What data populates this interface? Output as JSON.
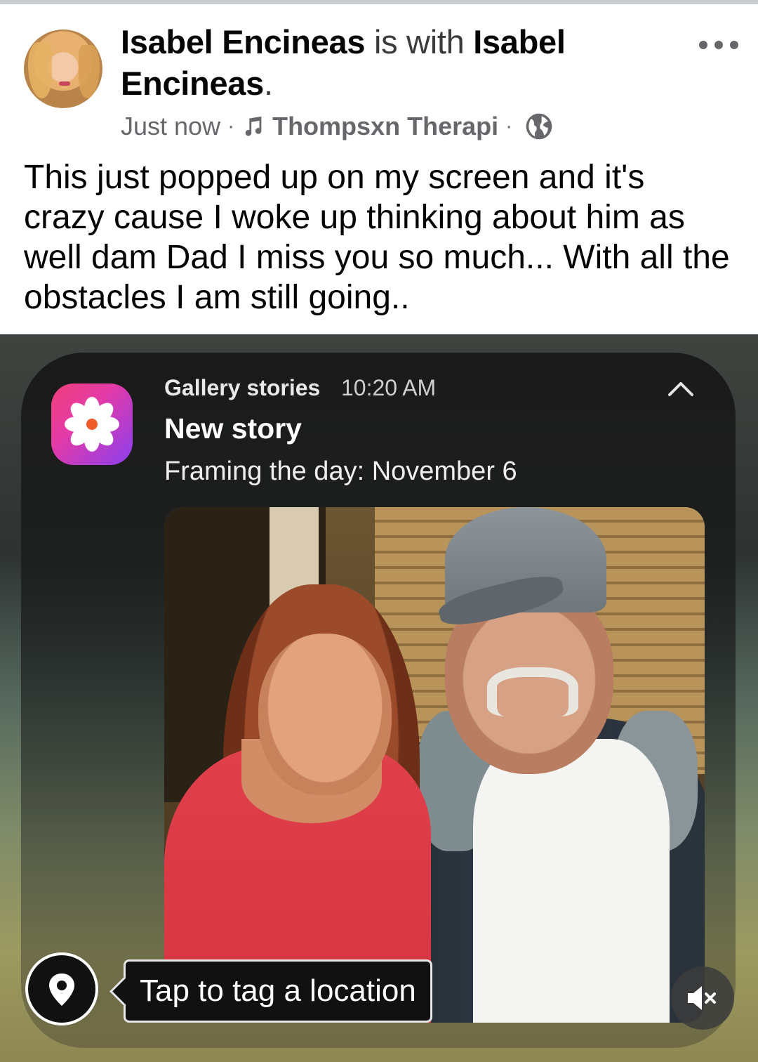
{
  "post": {
    "author": "Isabel Encineas",
    "connector": "is with",
    "tagged_person_line1": "Isabel",
    "tagged_person_line2": "Encineas",
    "period": ".",
    "timestamp": "Just now",
    "separator": "·",
    "song": "Thompsxn Therapi",
    "privacy_icon": "globe-icon",
    "more_icon": "more-options-icon",
    "text": "This just popped up on my screen and it's crazy cause I woke up thinking about him as well dam Dad I miss you so much... With all the obstacles I am still going.."
  },
  "notification": {
    "app_name": "Gallery stories",
    "time": "10:20 AM",
    "title": "New story",
    "body": "Framing the day: November 6",
    "app_icon": "flower-icon",
    "collapse_icon": "chevron-up-icon"
  },
  "overlay": {
    "location_icon": "location-pin-icon",
    "tag_location_label": "Tap to tag a location",
    "mute_icon": "speaker-muted-icon"
  },
  "colors": {
    "text_primary": "#050505",
    "text_secondary": "#65676b",
    "app_icon_gradient_start": "#f2407a",
    "app_icon_gradient_end": "#8a3ff0"
  }
}
